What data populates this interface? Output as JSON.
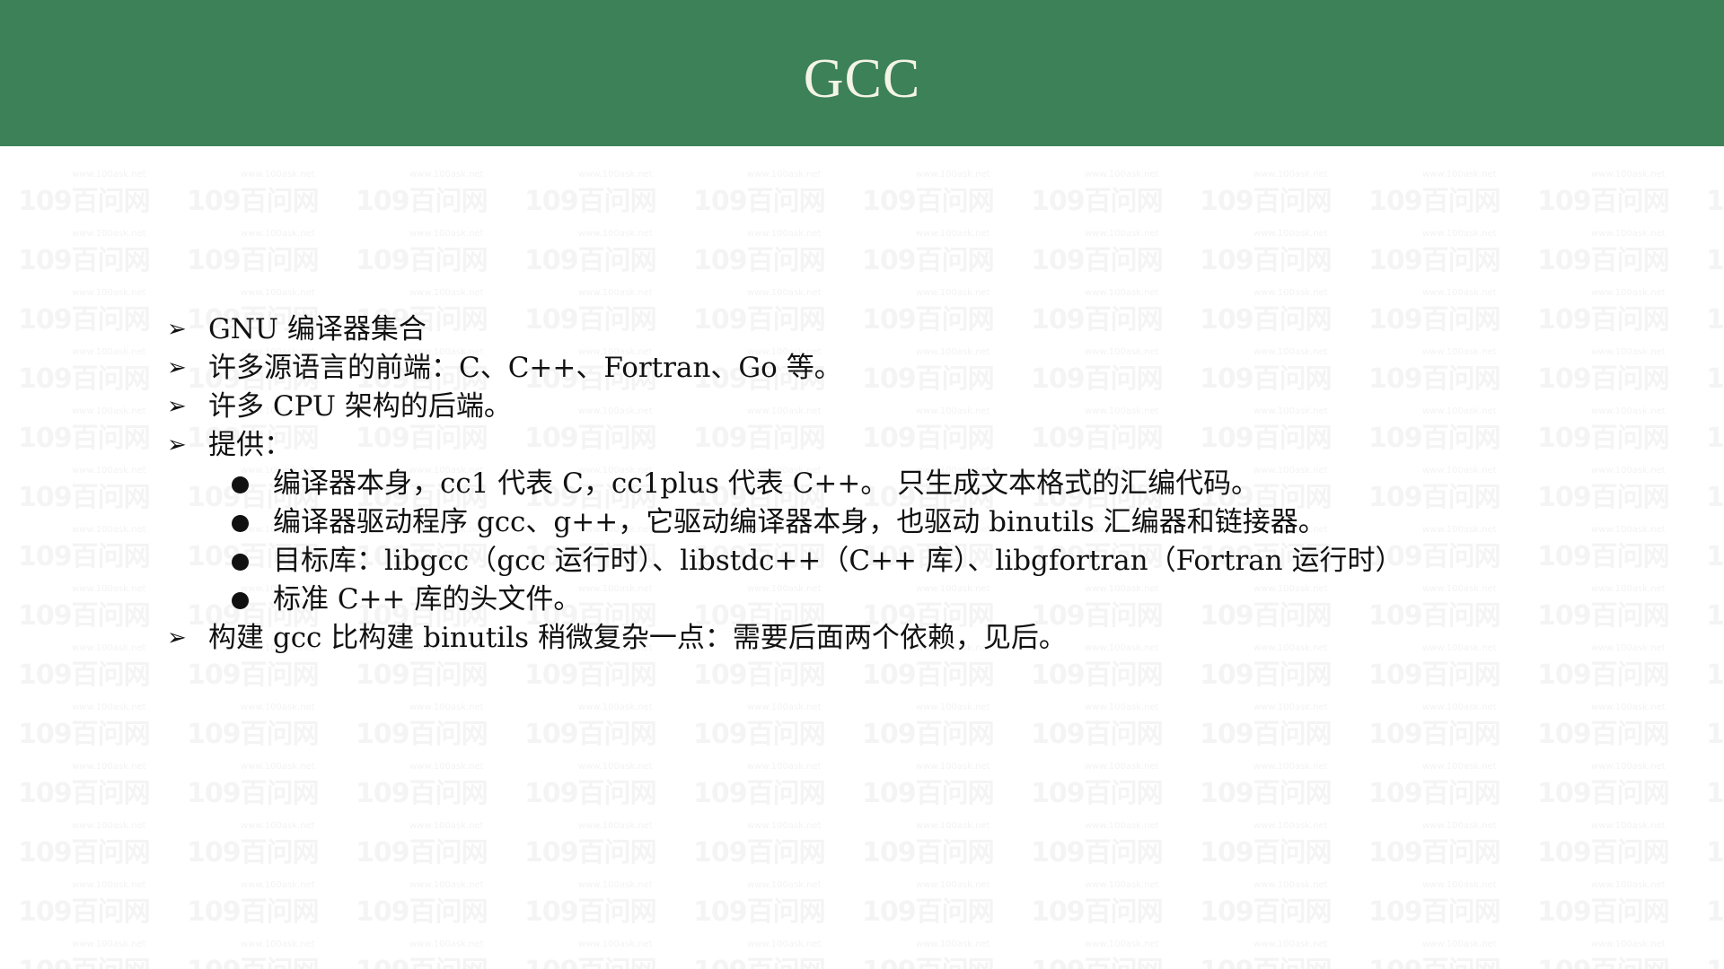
{
  "slide": {
    "title": "GCC",
    "watermark": "109百问网",
    "watermark_sub": "www.100ask.net"
  },
  "bullets": [
    {
      "level": 1,
      "marker": "➢",
      "text": "GNU 编译器集合"
    },
    {
      "level": 1,
      "marker": "➢",
      "text": "许多源语言的前端：C、C++、Fortran、Go 等。"
    },
    {
      "level": 1,
      "marker": "➢",
      "text": "许多 CPU 架构的后端。"
    },
    {
      "level": 1,
      "marker": "➢",
      "text": "提供："
    },
    {
      "level": 2,
      "marker": "●",
      "text": "编译器本身，cc1 代表 C，cc1plus 代表 C++。 只生成文本格式的汇编代码。"
    },
    {
      "level": 2,
      "marker": "●",
      "text": "编译器驱动程序 gcc、g++，它驱动编译器本身，也驱动 binutils 汇编器和链接器。"
    },
    {
      "level": 2,
      "marker": "●",
      "text": "目标库：libgcc（gcc 运行时）、libstdc++（C++ 库）、libgfortran（Fortran 运行时）"
    },
    {
      "level": 2,
      "marker": "●",
      "text": "标准 C++ 库的头文件。"
    },
    {
      "level": 1,
      "marker": "➢",
      "text": "构建 gcc 比构建 binutils 稍微复杂一点：需要后面两个依赖，见后。"
    }
  ],
  "colors": {
    "header_bg": "#3d8158",
    "title_text": "#f4f4e6",
    "body_text": "#111111",
    "watermark": "#f4f4f4"
  }
}
